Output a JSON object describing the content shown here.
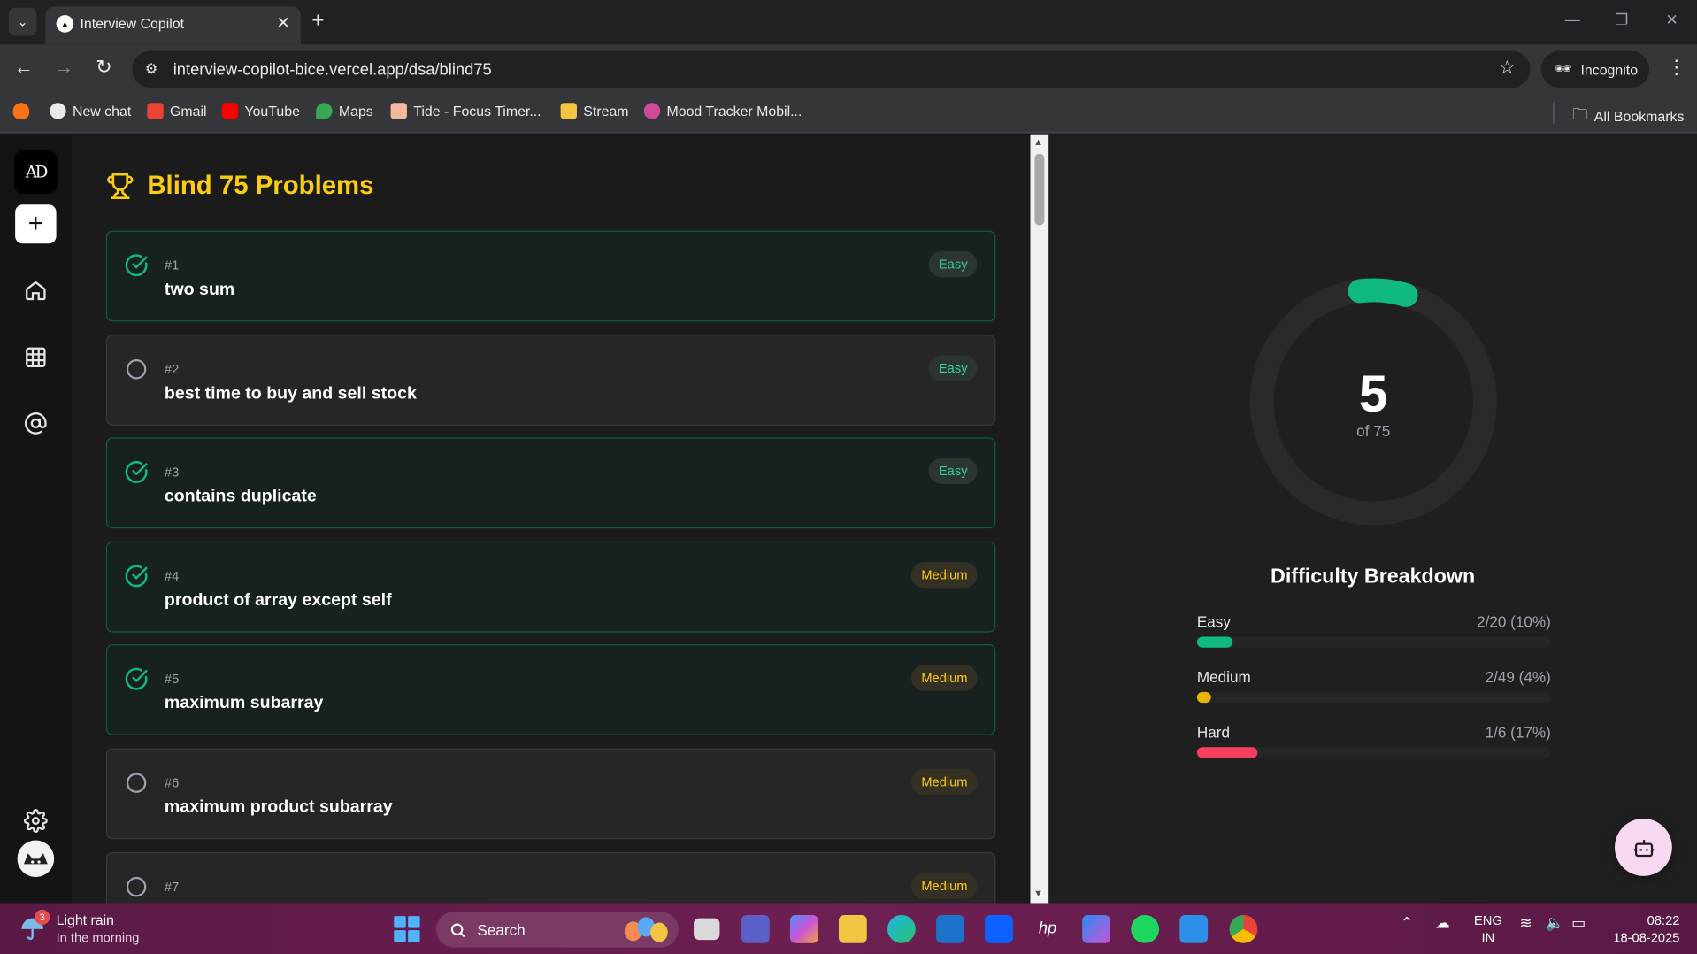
{
  "browser": {
    "tab_title": "Interview Copilot",
    "url": "interview-copilot-bice.vercel.app/dsa/blind75",
    "incognito_label": "Incognito",
    "bookmarks": [
      "New chat",
      "Gmail",
      "YouTube",
      "Maps",
      "Tide - Focus Timer...",
      "Stream",
      "Mood Tracker Mobil..."
    ],
    "all_bookmarks": "All Bookmarks"
  },
  "sidebar": {
    "logo": "AD",
    "icons": [
      "plus-icon",
      "home-icon",
      "grid-icon",
      "at-icon",
      "gear-icon",
      "avatar"
    ]
  },
  "page": {
    "title": "Blind 75 Problems"
  },
  "problems": [
    {
      "num": "#1",
      "name": "two sum",
      "difficulty": "Easy",
      "solved": true
    },
    {
      "num": "#2",
      "name": "best time to buy and sell stock",
      "difficulty": "Easy",
      "solved": false
    },
    {
      "num": "#3",
      "name": "contains duplicate",
      "difficulty": "Easy",
      "solved": true
    },
    {
      "num": "#4",
      "name": "product of array except self",
      "difficulty": "Medium",
      "solved": true
    },
    {
      "num": "#5",
      "name": "maximum subarray",
      "difficulty": "Medium",
      "solved": true
    },
    {
      "num": "#6",
      "name": "maximum product subarray",
      "difficulty": "Medium",
      "solved": false
    },
    {
      "num": "#7",
      "name": "",
      "difficulty": "Medium",
      "solved": false
    }
  ],
  "progress": {
    "solved": "5",
    "total_label": "of 75",
    "fraction": 0.0667,
    "breakdown_title": "Difficulty Breakdown",
    "breakdown": [
      {
        "label": "Easy",
        "value": "2/20 (10%)",
        "fraction": 0.1,
        "color": "#10b981"
      },
      {
        "label": "Medium",
        "value": "2/49 (4%)",
        "fraction": 0.04,
        "color": "#eab308"
      },
      {
        "label": "Hard",
        "value": "1/6 (17%)",
        "fraction": 0.17,
        "color": "#f43f5e"
      }
    ]
  },
  "colors": {
    "accent": "#facc15",
    "solved": "#10b981",
    "easy": "#34d399",
    "medium": "#facc15",
    "ring_track": "#2a2a2a"
  },
  "taskbar": {
    "weather_line1": "Light rain",
    "weather_line2": "In the morning",
    "weather_badge": "3",
    "search": "Search",
    "lang_line1": "ENG",
    "lang_line2": "IN",
    "time": "08:22",
    "date": "18-08-2025"
  }
}
